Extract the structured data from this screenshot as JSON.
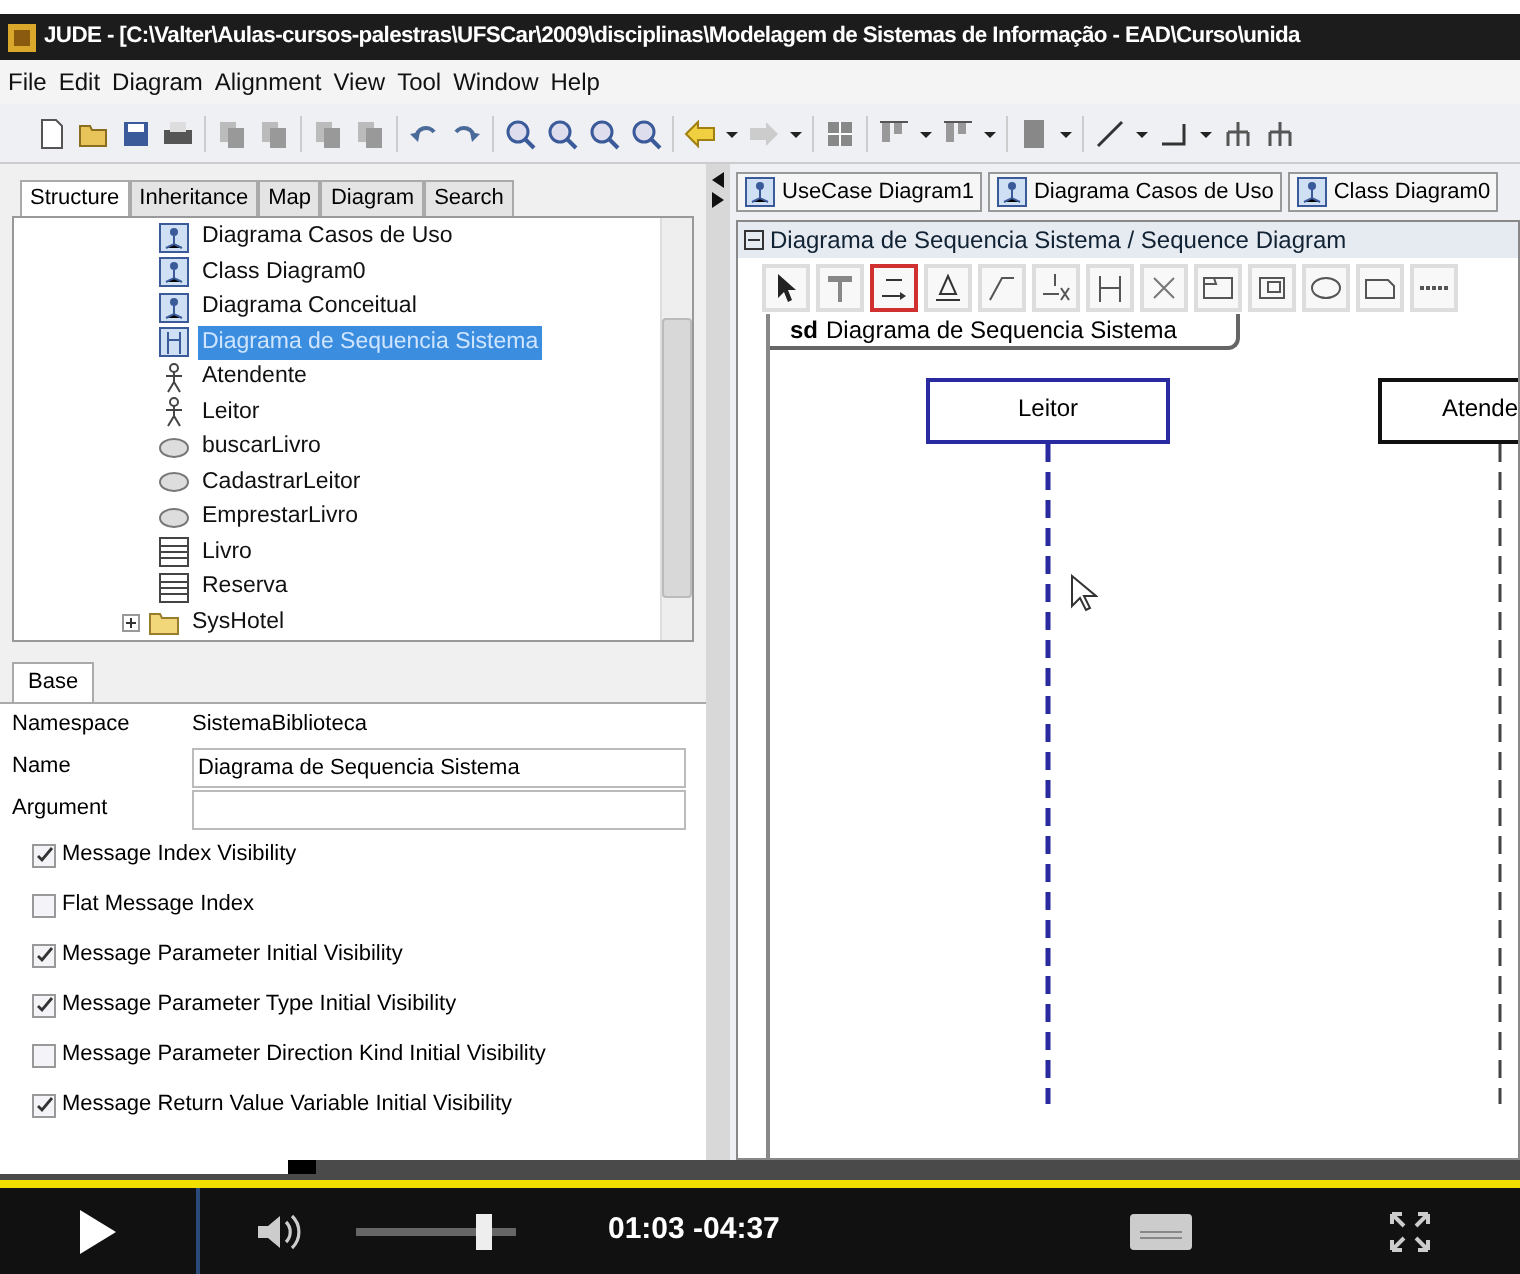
{
  "window": {
    "title": "JUDE - [C:\\Valter\\Aulas-cursos-palestras\\UFSCar\\2009\\disciplinas\\Modelagem de Sistemas de Informação - EAD\\Curso\\unida"
  },
  "menu": [
    "File",
    "Edit",
    "Diagram",
    "Alignment",
    "View",
    "Tool",
    "Window",
    "Help"
  ],
  "left_tabs": [
    {
      "label": "Structure",
      "selected": true
    },
    {
      "label": "Inheritance",
      "selected": false
    },
    {
      "label": "Map",
      "selected": false
    },
    {
      "label": "Diagram",
      "selected": false
    },
    {
      "label": "Search",
      "selected": false
    }
  ],
  "tree": [
    {
      "children": [
        {
          "label": "Diagrama Casos de Uso",
          "kind": "diagram",
          "selected": false
        },
        {
          "label": "Class Diagram0",
          "kind": "diagram",
          "selected": false
        },
        {
          "label": "Diagrama Conceitual",
          "kind": "diagram",
          "selected": false
        },
        {
          "label": "Diagrama de Sequencia Sistema",
          "kind": "sequence",
          "selected": true
        },
        {
          "label": "Atendente",
          "kind": "actor",
          "selected": false
        },
        {
          "label": "Leitor",
          "kind": "actor",
          "selected": false
        },
        {
          "label": "buscarLivro",
          "kind": "usecase",
          "selected": false
        },
        {
          "label": "CadastrarLeitor",
          "kind": "usecase",
          "selected": false
        },
        {
          "label": "EmprestarLivro",
          "kind": "usecase",
          "selected": false
        },
        {
          "label": "Livro",
          "kind": "class",
          "selected": false
        },
        {
          "label": "Reserva",
          "kind": "class",
          "selected": false
        }
      ]
    },
    {
      "label": "SysHotel",
      "kind": "folder",
      "selected": false,
      "expanded": false
    }
  ],
  "properties": {
    "tab": "Base",
    "fields": [
      {
        "label": "Namespace",
        "value": "SistemaBiblioteca",
        "kind": "text"
      },
      {
        "label": "Name",
        "value": "Diagrama de Sequencia Sistema",
        "kind": "input"
      },
      {
        "label": "Argument",
        "kind": "input"
      }
    ],
    "checkboxes": [
      {
        "label": "Message Index Visibility",
        "checked": true
      },
      {
        "label": "Flat Message Index",
        "checked": false
      },
      {
        "label": "Message Parameter Initial Visibility",
        "checked": true
      },
      {
        "label": "Message Parameter Type Initial Visibility",
        "checked": true
      },
      {
        "label": "Message Parameter Direction Kind Initial Visibility",
        "checked": false
      },
      {
        "label": "Message Return Value Variable Initial Visibility",
        "checked": true
      }
    ]
  },
  "diagram_tabs": [
    "UseCase Diagram1",
    "Diagrama Casos de Uso",
    "Class Diagram0"
  ],
  "diagram": {
    "title": "Diagrama de Sequencia Sistema / Sequence Diagram",
    "palette": [
      {
        "selected": false
      },
      {
        "selected": false
      },
      {
        "selected": true
      },
      {
        "selected": false
      },
      {
        "selected": false
      },
      {
        "selected": false
      },
      {
        "selected": false
      },
      {
        "selected": false
      },
      {
        "selected": false
      },
      {
        "selected": false
      },
      {
        "selected": false
      },
      {
        "selected": false
      },
      {
        "selected": false
      }
    ],
    "frame_prefix": "sd",
    "frame_name": "Diagrama de Sequencia Sistema",
    "lifelines": [
      {
        "name": "Leitor",
        "selected": true
      },
      {
        "name": "Atende",
        "selected": false
      }
    ]
  },
  "player": {
    "progress": {
      "level": 0.19
    },
    "volume": {
      "level": 0.85
    },
    "time": "01:03 -04:37"
  }
}
